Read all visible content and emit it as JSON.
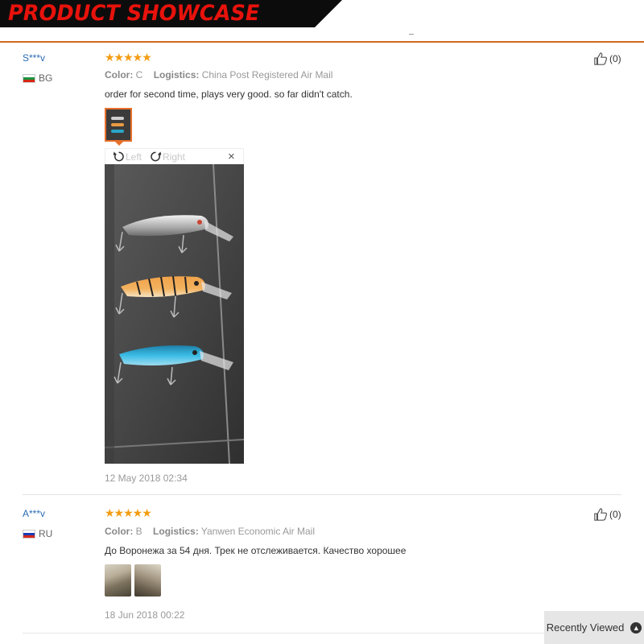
{
  "banner": {
    "title": "PRODUCT SHOWCASE"
  },
  "reviews": [
    {
      "user": "S***v",
      "country": "BG",
      "stars": "★★★★★",
      "color_label": "Color:",
      "color_value": "C",
      "logistics_label": "Logistics:",
      "logistics_value": "China Post Registered Air Mail",
      "text": "order for second time, plays very good. so far didn't catch.",
      "date": "12 May 2018 02:34",
      "helpful_count": "(0)"
    },
    {
      "user": "A***v",
      "country": "RU",
      "stars": "★★★★★",
      "color_label": "Color:",
      "color_value": "B",
      "logistics_label": "Logistics:",
      "logistics_value": "Yanwen Economic Air Mail",
      "text": "До Воронежа за 54 дня. Трек не отслеживается. Качество хорошее",
      "date": "18 Jun 2018 00:22",
      "helpful_count": "(0)"
    }
  ],
  "viewer": {
    "rotate_left": "Left",
    "rotate_right": "Right",
    "close": "×"
  },
  "recently_viewed": {
    "label": "Recently Viewed",
    "icon": "chevron-up-icon"
  },
  "colors": {
    "banner_red": "#e8120c",
    "accent_orange": "#d4681e",
    "star": "#f39c12",
    "user_link": "#2a6bb5"
  }
}
